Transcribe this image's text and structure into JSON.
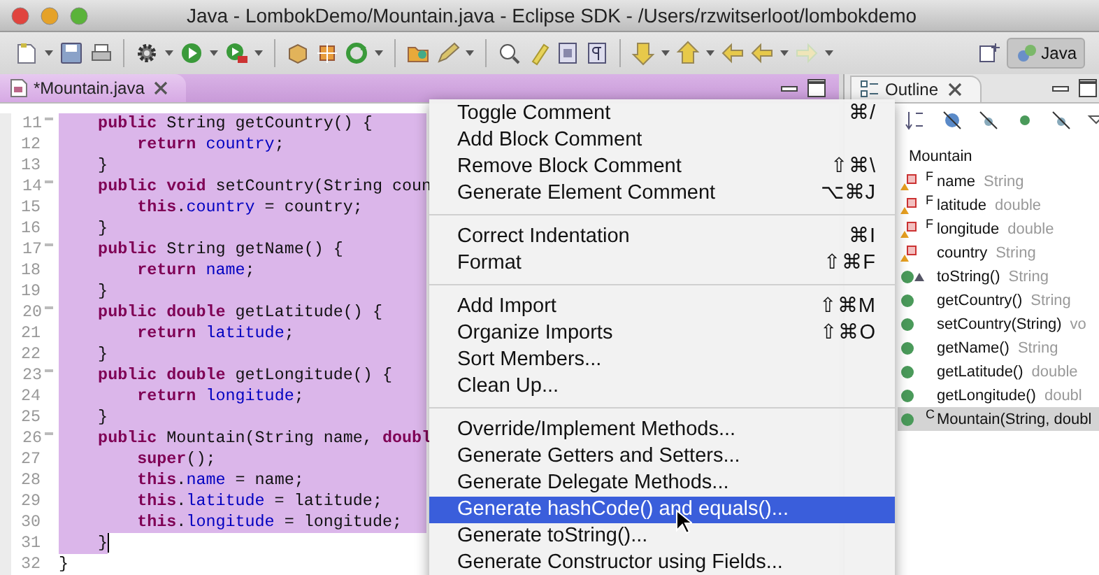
{
  "window": {
    "title": "Java - LombokDemo/Mountain.java - Eclipse SDK - /Users/rzwitserloot/lombokdemo"
  },
  "perspective": {
    "label": "Java",
    "selected": true
  },
  "editor": {
    "tab": {
      "label": "*Mountain.java",
      "selected": true
    },
    "lines": [
      {
        "number": "11",
        "fold": true,
        "selected": true,
        "caret": false,
        "segments": [
          {
            "kind": "keyword",
            "text": "    public"
          },
          {
            "kind": "plain",
            "text": " String getCountry() {"
          }
        ]
      },
      {
        "number": "12",
        "fold": false,
        "selected": true,
        "caret": false,
        "segments": [
          {
            "kind": "keyword",
            "text": "        return "
          },
          {
            "kind": "field",
            "text": "country"
          },
          {
            "kind": "plain",
            "text": ";"
          }
        ]
      },
      {
        "number": "13",
        "fold": false,
        "selected": true,
        "caret": false,
        "segments": [
          {
            "kind": "plain",
            "text": "    }"
          }
        ]
      },
      {
        "number": "14",
        "fold": true,
        "selected": true,
        "caret": false,
        "segments": [
          {
            "kind": "keyword",
            "text": "    public void"
          },
          {
            "kind": "plain",
            "text": " setCountry(String coun"
          }
        ]
      },
      {
        "number": "15",
        "fold": false,
        "selected": true,
        "caret": false,
        "segments": [
          {
            "kind": "keyword",
            "text": "        this"
          },
          {
            "kind": "plain",
            "text": "."
          },
          {
            "kind": "field",
            "text": "country"
          },
          {
            "kind": "plain",
            "text": " = country;"
          }
        ]
      },
      {
        "number": "16",
        "fold": false,
        "selected": true,
        "caret": false,
        "segments": [
          {
            "kind": "plain",
            "text": "    }"
          }
        ]
      },
      {
        "number": "17",
        "fold": true,
        "selected": true,
        "caret": false,
        "segments": [
          {
            "kind": "keyword",
            "text": "    public"
          },
          {
            "kind": "plain",
            "text": " String getName() {"
          }
        ]
      },
      {
        "number": "18",
        "fold": false,
        "selected": true,
        "caret": false,
        "segments": [
          {
            "kind": "keyword",
            "text": "        return "
          },
          {
            "kind": "field",
            "text": "name"
          },
          {
            "kind": "plain",
            "text": ";"
          }
        ]
      },
      {
        "number": "19",
        "fold": false,
        "selected": true,
        "caret": false,
        "segments": [
          {
            "kind": "plain",
            "text": "    }"
          }
        ]
      },
      {
        "number": "20",
        "fold": true,
        "selected": true,
        "caret": false,
        "segments": [
          {
            "kind": "keyword",
            "text": "    public double"
          },
          {
            "kind": "plain",
            "text": " getLatitude() {"
          }
        ]
      },
      {
        "number": "21",
        "fold": false,
        "selected": true,
        "caret": false,
        "segments": [
          {
            "kind": "keyword",
            "text": "        return "
          },
          {
            "kind": "field",
            "text": "latitude"
          },
          {
            "kind": "plain",
            "text": ";"
          }
        ]
      },
      {
        "number": "22",
        "fold": false,
        "selected": true,
        "caret": false,
        "segments": [
          {
            "kind": "plain",
            "text": "    }"
          }
        ]
      },
      {
        "number": "23",
        "fold": true,
        "selected": true,
        "caret": false,
        "segments": [
          {
            "kind": "keyword",
            "text": "    public double"
          },
          {
            "kind": "plain",
            "text": " getLongitude() {"
          }
        ]
      },
      {
        "number": "24",
        "fold": false,
        "selected": true,
        "caret": false,
        "segments": [
          {
            "kind": "keyword",
            "text": "        return "
          },
          {
            "kind": "field",
            "text": "longitude"
          },
          {
            "kind": "plain",
            "text": ";"
          }
        ]
      },
      {
        "number": "25",
        "fold": false,
        "selected": true,
        "caret": false,
        "segments": [
          {
            "kind": "plain",
            "text": "    }"
          }
        ]
      },
      {
        "number": "26",
        "fold": true,
        "selected": true,
        "caret": false,
        "segments": [
          {
            "kind": "keyword",
            "text": "    public"
          },
          {
            "kind": "plain",
            "text": " Mountain(String name, "
          },
          {
            "kind": "keyword",
            "text": "doubl"
          }
        ]
      },
      {
        "number": "27",
        "fold": false,
        "selected": true,
        "caret": false,
        "segments": [
          {
            "kind": "keyword",
            "text": "        super"
          },
          {
            "kind": "plain",
            "text": "();"
          }
        ]
      },
      {
        "number": "28",
        "fold": false,
        "selected": true,
        "caret": false,
        "segments": [
          {
            "kind": "keyword",
            "text": "        this"
          },
          {
            "kind": "plain",
            "text": "."
          },
          {
            "kind": "field",
            "text": "name"
          },
          {
            "kind": "plain",
            "text": " = name;"
          }
        ]
      },
      {
        "number": "29",
        "fold": false,
        "selected": true,
        "caret": false,
        "segments": [
          {
            "kind": "keyword",
            "text": "        this"
          },
          {
            "kind": "plain",
            "text": "."
          },
          {
            "kind": "field",
            "text": "latitude"
          },
          {
            "kind": "plain",
            "text": " = latitude;"
          }
        ]
      },
      {
        "number": "30",
        "fold": false,
        "selected": true,
        "caret": false,
        "segments": [
          {
            "kind": "keyword",
            "text": "        this"
          },
          {
            "kind": "plain",
            "text": "."
          },
          {
            "kind": "field",
            "text": "longitude"
          },
          {
            "kind": "plain",
            "text": " = longitude;"
          }
        ]
      },
      {
        "number": "31",
        "fold": false,
        "selected": true,
        "caret": true,
        "segments": [
          {
            "kind": "plain",
            "text": "    }"
          }
        ]
      },
      {
        "number": "32",
        "fold": false,
        "selected": false,
        "caret": false,
        "segments": [
          {
            "kind": "plain",
            "text": "}"
          }
        ]
      }
    ]
  },
  "context_menu": {
    "groups": [
      [
        {
          "label": "Toggle Comment",
          "shortcut": "⌘/",
          "selected": false
        },
        {
          "label": "Add Block Comment",
          "selected": false
        },
        {
          "label": "Remove Block Comment",
          "shortcut": "⇧⌘\\",
          "selected": false
        },
        {
          "label": "Generate Element Comment",
          "shortcut": "⌥⌘J",
          "selected": false
        }
      ],
      [
        {
          "label": "Correct Indentation",
          "shortcut": "⌘I",
          "selected": false
        },
        {
          "label": "Format",
          "shortcut": "⇧⌘F",
          "selected": false
        }
      ],
      [
        {
          "label": "Add Import",
          "shortcut": "⇧⌘M",
          "selected": false
        },
        {
          "label": "Organize Imports",
          "shortcut": "⇧⌘O",
          "selected": false
        },
        {
          "label": "Sort Members...",
          "selected": false
        },
        {
          "label": "Clean Up...",
          "selected": false
        }
      ],
      [
        {
          "label": "Override/Implement Methods...",
          "selected": false
        },
        {
          "label": "Generate Getters and Setters...",
          "selected": false
        },
        {
          "label": "Generate Delegate Methods...",
          "selected": false
        },
        {
          "label": "Generate hashCode() and equals()...",
          "selected": true
        },
        {
          "label": "Generate toString()...",
          "selected": false
        },
        {
          "label": "Generate Constructor using Fields...",
          "selected": false
        }
      ]
    ]
  },
  "outline": {
    "tab": {
      "label": "Outline",
      "selected": true
    },
    "root": {
      "label": "Mountain",
      "children": [
        {
          "kind": "field",
          "badge": "F",
          "name": "name",
          "type": "String",
          "override": false,
          "selected": false
        },
        {
          "kind": "field",
          "badge": "F",
          "name": "latitude",
          "type": "double",
          "override": false,
          "selected": false
        },
        {
          "kind": "field",
          "badge": "F",
          "name": "longitude",
          "type": "double",
          "override": false,
          "selected": false
        },
        {
          "kind": "field",
          "name": "country",
          "type": "String",
          "override": false,
          "selected": false
        },
        {
          "kind": "method",
          "name": "toString()",
          "type": "String",
          "override": true,
          "selected": false
        },
        {
          "kind": "method",
          "name": "getCountry()",
          "type": "String",
          "override": false,
          "selected": false
        },
        {
          "kind": "method",
          "name": "setCountry(String)",
          "type": "vo",
          "override": false,
          "selected": false
        },
        {
          "kind": "method",
          "name": "getName()",
          "type": "String",
          "override": false,
          "selected": false
        },
        {
          "kind": "method",
          "name": "getLatitude()",
          "type": "double",
          "override": false,
          "selected": false
        },
        {
          "kind": "method",
          "name": "getLongitude()",
          "type": "doubl",
          "override": false,
          "selected": false
        },
        {
          "kind": "method",
          "badge": "C",
          "name": "Mountain(String, doubl",
          "override": false,
          "selected": true
        }
      ]
    }
  }
}
